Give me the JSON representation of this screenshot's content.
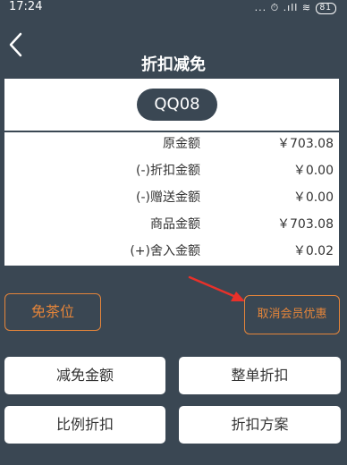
{
  "status_bar": {
    "time": "17:24",
    "indicators": "... ⏱ .ıll ≋",
    "battery": "81"
  },
  "header": {
    "title": "折扣减免"
  },
  "room": {
    "code": "QQ08"
  },
  "summary_rows": [
    {
      "label": "原金额",
      "value": "￥703.08"
    },
    {
      "label": "(-)折扣金额",
      "value": "￥0.00"
    },
    {
      "label": "(-)赠送金额",
      "value": "￥0.00"
    },
    {
      "label": "商品金额",
      "value": "￥703.08"
    },
    {
      "label": "(+)舍入金额",
      "value": "￥0.02"
    }
  ],
  "buttons": {
    "free_seat": "免茶位",
    "cancel_member_discount": "取消会员优惠",
    "reduce_amount": "减免金额",
    "whole_order_discount": "整单折扣",
    "ratio_discount": "比例折扣",
    "discount_plan": "折扣方案"
  },
  "colors": {
    "background": "#3a4753",
    "accent_orange": "#e5853a",
    "annotation_red": "#e8312a"
  }
}
